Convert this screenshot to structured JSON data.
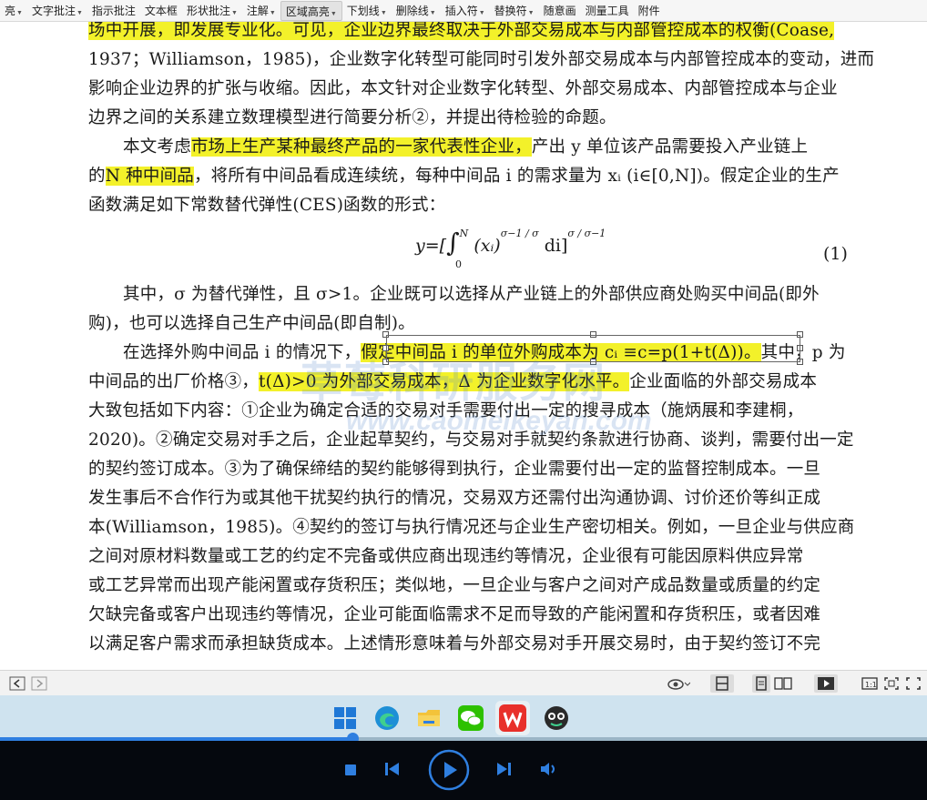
{
  "toolbar": {
    "items": [
      {
        "label": "亮",
        "has_menu": true
      },
      {
        "label": "文字批注",
        "has_menu": true
      },
      {
        "label": "指示批注",
        "has_menu": false
      },
      {
        "label": "文本框",
        "has_menu": false
      },
      {
        "label": "形状批注",
        "has_menu": true
      },
      {
        "label": "注解",
        "has_menu": true
      },
      {
        "label": "区域高亮",
        "has_menu": true,
        "active": true
      },
      {
        "label": "下划线",
        "has_menu": true
      },
      {
        "label": "删除线",
        "has_menu": true
      },
      {
        "label": "插入符",
        "has_menu": true
      },
      {
        "label": "替换符",
        "has_menu": true
      },
      {
        "label": "随意画",
        "has_menu": false
      },
      {
        "label": "测量工具",
        "has_menu": false
      },
      {
        "label": "附件",
        "has_menu": false
      }
    ]
  },
  "document": {
    "lines": [
      {
        "text": "场中开展，即发展专业化。可见，企业边界最终取决于外部交易成本与内部管控成本的权衡(Coase,"
      },
      {
        "text": "1937；Williamson，1985)，企业数字化转型可能同时引发外部交易成本与内部管控成本的变动，进而"
      },
      {
        "text": "影响企业边界的扩张与收缩。因此，本文针对企业数字化转型、外部交易成本、内部管控成本与企业"
      },
      {
        "text": "边界之间的关系建立数理模型进行简要分析②，并提出待检验的命题。"
      },
      {
        "pre": "本文考虑",
        "hl": "市场上生产某种最终产品的一家代表性企业，",
        "post": "产出 y 单位该产品需要投入产业链上"
      },
      {
        "pre": "的",
        "hl": "N 种中间品",
        "post": "，将所有中间品看成连续统，每种中间品 i 的需求量为 xᵢ (i∈[0,N])。假定企业的生产"
      },
      {
        "text": "函数满足如下常数替代弹性(CES)函数的形式："
      },
      {
        "text": "其中，σ 为替代弹性，且 σ>1。企业既可以选择从产业链上的外部供应商处购买中间品(即外"
      },
      {
        "text": "购)，也可以选择自己生产中间品(即自制)。"
      },
      {
        "pre": "在选择外购中间品 i 的情况下，",
        "hl": "假定中间品 i 的单位外购成本为 cᵢ ≡c=p(1+t(Δ))。",
        "post": "其中，p 为"
      },
      {
        "pre": "中间品的出厂价格③，",
        "hl": "t(Δ)>0 为外部交易成本，Δ 为企业数字化水平。",
        "post": "企业面临的外部交易成本"
      },
      {
        "text": "大致包括如下内容：①企业为确定合适的交易对手需要付出一定的搜寻成本（施炳展和李建桐，"
      },
      {
        "text": "2020)。②确定交易对手之后，企业起草契约，与交易对手就契约条款进行协商、谈判，需要付出一定"
      },
      {
        "text": "的契约签订成本。③为了确保缔结的契约能够得到执行，企业需要付出一定的监督控制成本。一旦"
      },
      {
        "text": "发生事后不合作行为或其他干扰契约执行的情况，交易双方还需付出沟通协调、讨价还价等纠正成"
      },
      {
        "text": "本(Williamson，1985)。④契约的签订与执行情况还与企业生产密切相关。例如，一旦企业与供应商"
      },
      {
        "text": "之间对原材料数量或工艺的约定不完备或供应商出现违约等情况，企业很有可能因原料供应异常"
      },
      {
        "text": "或工艺异常而出现产能闲置或存货积压；类似地，一旦企业与客户之间对产成品数量或质量的约定"
      },
      {
        "text": "欠缺完备或客户出现违约等情况，企业可能面临需求不足而导致的产能闲置和存货积压，或者因难"
      },
      {
        "text": "以满足客户需求而承担缺货成本。上述情形意味着与外部交易对手开展交易时，由于契约签订不完"
      }
    ],
    "formula": {
      "lhs": "y=[",
      "integral": "∫",
      "upper": "N",
      "lower": "0",
      "body": "(xᵢ)",
      "exp1": "σ−1 / σ",
      "tail": "di]",
      "exp2": "σ / σ−1"
    },
    "equation_number": "(1)",
    "watermark_1": "草莓科研服务网",
    "watermark_2": "www.caomeikeyan.com"
  },
  "statusbar": {
    "icons": [
      "prev-page-icon",
      "next-page-icon",
      "eye-protection-icon",
      "single-page-icon",
      "page-view-icon",
      "two-page-icon",
      "play-icon",
      "actual-size-icon",
      "fit-page-icon",
      "fullscreen-icon"
    ]
  },
  "taskbar": {
    "apps": [
      "windows-start",
      "edge",
      "file-explorer",
      "wechat",
      "wps-office",
      "avatar-app"
    ],
    "playback_progress": 0.38
  },
  "player": {
    "controls": [
      "stop",
      "previous",
      "play",
      "next",
      "volume"
    ]
  },
  "colors": {
    "highlight": "#f3f12a",
    "accent": "#2f7fe0",
    "taskbar_bg": "#cfe3ef",
    "player_bg": "#05080e"
  }
}
